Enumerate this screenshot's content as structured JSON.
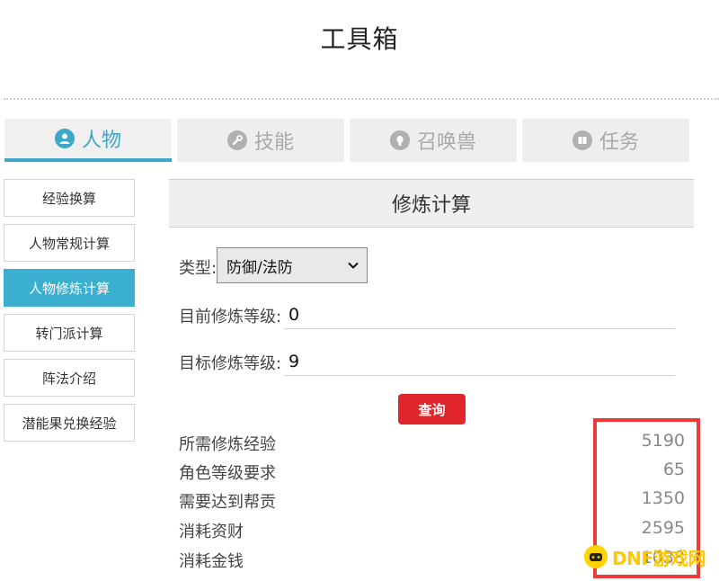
{
  "header": {
    "title": "工具箱"
  },
  "tabs": [
    {
      "label": "人物",
      "icon": "person-icon",
      "active": true
    },
    {
      "label": "技能",
      "icon": "wrench-icon",
      "active": false
    },
    {
      "label": "召唤兽",
      "icon": "pet-icon",
      "active": false
    },
    {
      "label": "任务",
      "icon": "book-icon",
      "active": false
    }
  ],
  "sidebar": {
    "items": [
      {
        "label": "经验换算"
      },
      {
        "label": "人物常规计算"
      },
      {
        "label": "人物修炼计算",
        "active": true
      },
      {
        "label": "转门派计算"
      },
      {
        "label": "阵法介绍"
      },
      {
        "label": "潜能果兑换经验"
      }
    ]
  },
  "panel": {
    "title": "修炼计算",
    "type_label": "类型:",
    "type_value": "防御/法防",
    "current_label": "目前修炼等级:",
    "current_value": "0",
    "target_label": "目标修炼等级:",
    "target_value": "9",
    "query_label": "查询"
  },
  "results": [
    {
      "label": "所需修炼经验",
      "value": "5190"
    },
    {
      "label": "角色等级要求",
      "value": "65"
    },
    {
      "label": "需要达到帮贡",
      "value": "1350"
    },
    {
      "label": "消耗资财",
      "value": "2595"
    },
    {
      "label": "消耗金钱",
      "value": "1038"
    }
  ],
  "watermark": {
    "text": "DNF游戏网"
  },
  "colors": {
    "accent": "#3aafcf",
    "button": "#e0262b",
    "highlight": "#ef3a3a",
    "watermark": "#ffc800"
  }
}
